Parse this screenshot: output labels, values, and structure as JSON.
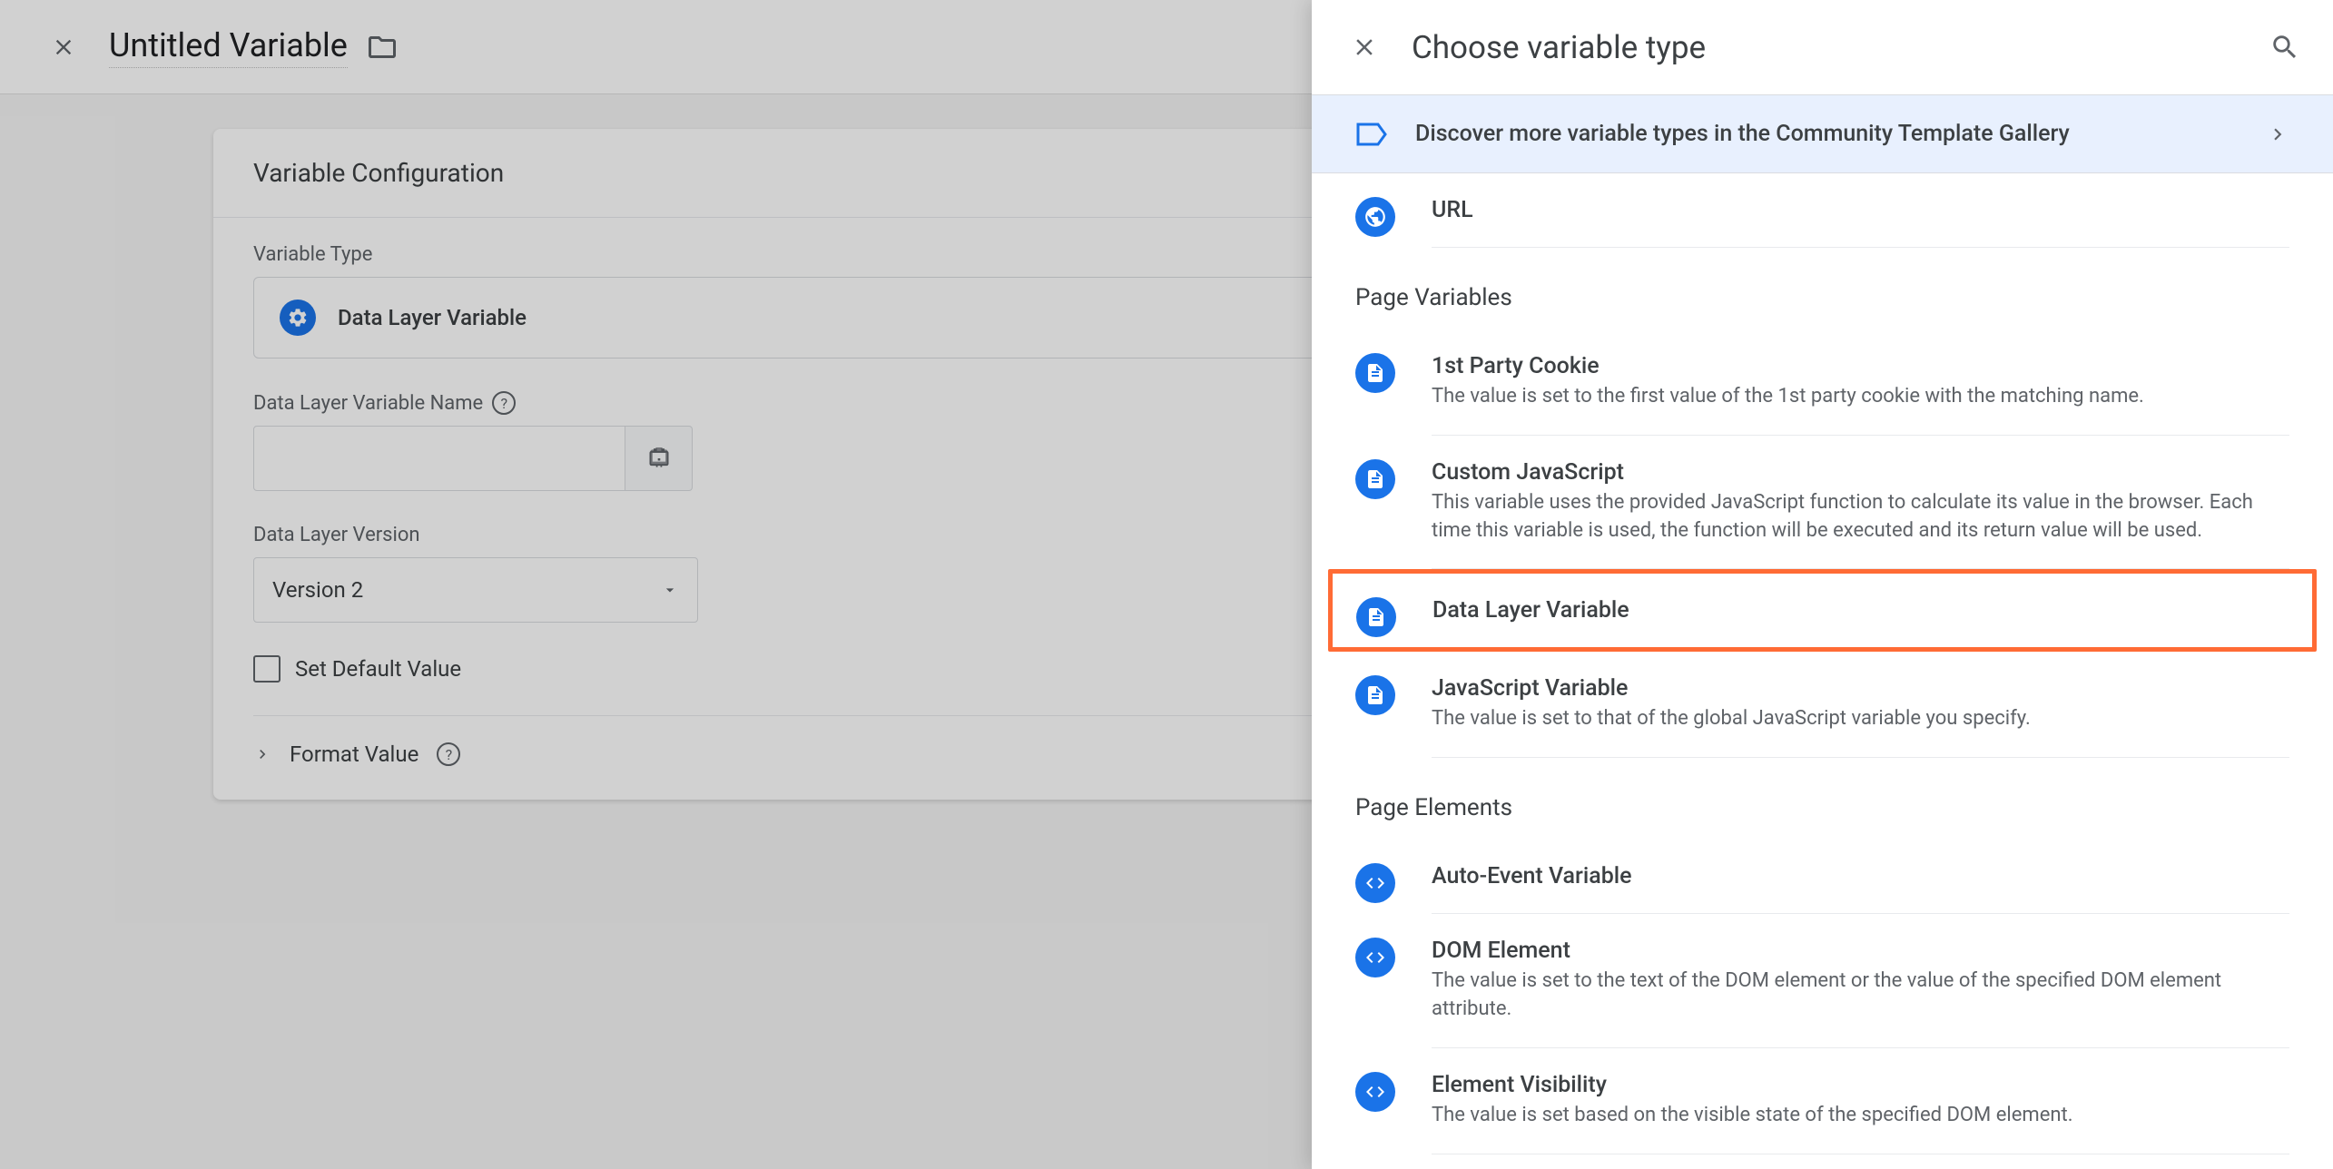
{
  "main": {
    "title": "Untitled Variable",
    "config_title": "Variable Configuration",
    "variable_type_label": "Variable Type",
    "selected_type": "Data Layer Variable",
    "dlv_name_label": "Data Layer Variable Name",
    "dlv_name_value": "",
    "version_label": "Data Layer Version",
    "version_value": "Version 2",
    "set_default_label": "Set Default Value",
    "format_value_label": "Format Value"
  },
  "panel": {
    "title": "Choose variable type",
    "discover_text": "Discover more variable types in the Community Template Gallery",
    "sections": [
      {
        "label": null,
        "items": [
          {
            "icon": "globe",
            "title": "URL",
            "desc": null
          }
        ]
      },
      {
        "label": "Page Variables",
        "items": [
          {
            "icon": "doc",
            "title": "1st Party Cookie",
            "desc": "The value is set to the first value of the 1st party cookie with the matching name."
          },
          {
            "icon": "doc",
            "title": "Custom JavaScript",
            "desc": "This variable uses the provided JavaScript function to calculate its value in the browser. Each time this variable is used, the function will be executed and its return value will be used."
          },
          {
            "icon": "doc",
            "title": "Data Layer Variable",
            "desc": null,
            "highlighted": true
          },
          {
            "icon": "doc",
            "title": "JavaScript Variable",
            "desc": "The value is set to that of the global JavaScript variable you specify."
          }
        ]
      },
      {
        "label": "Page Elements",
        "items": [
          {
            "icon": "code",
            "title": "Auto-Event Variable",
            "desc": null
          },
          {
            "icon": "code",
            "title": "DOM Element",
            "desc": "The value is set to the text of the DOM element or the value of the specified DOM element attribute."
          },
          {
            "icon": "code",
            "title": "Element Visibility",
            "desc": "The value is set based on the visible state of the specified DOM element."
          }
        ]
      }
    ]
  }
}
